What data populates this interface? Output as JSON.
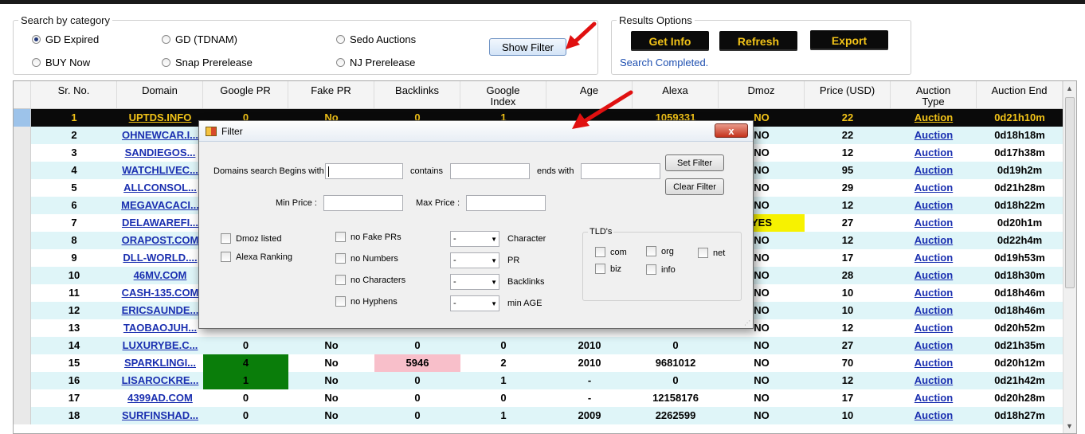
{
  "search_category": {
    "legend": "Search by category",
    "options": [
      {
        "label": "GD Expired",
        "selected": true
      },
      {
        "label": "GD (TDNAM)",
        "selected": false
      },
      {
        "label": "Sedo Auctions",
        "selected": false
      },
      {
        "label": "BUY Now",
        "selected": false
      },
      {
        "label": "Snap Prerelease",
        "selected": false
      },
      {
        "label": "NJ Prerelease",
        "selected": false
      }
    ],
    "show_filter": "Show Filter"
  },
  "results_options": {
    "legend": "Results Options",
    "get_info": "Get Info",
    "refresh": "Refresh",
    "export": "Export",
    "status": "Search Completed."
  },
  "table": {
    "columns": [
      "Sr. No.",
      "Domain",
      "Google PR",
      "Fake PR",
      "Backlinks",
      "Google\nIndex",
      "Age",
      "Alexa",
      "Dmoz",
      "Price (USD)",
      "Auction\nType",
      "Auction End"
    ],
    "rows": [
      [
        "1",
        "UPTDS.INFO",
        "0",
        "No",
        "0",
        "1",
        "",
        "1059331",
        "NO",
        "22",
        "Auction",
        "0d21h10m"
      ],
      [
        "2",
        "OHNEWCAR.I...",
        "",
        "",
        "",
        "",
        "",
        "",
        "NO",
        "22",
        "Auction",
        "0d18h18m"
      ],
      [
        "3",
        "SANDIEGOS...",
        "",
        "",
        "",
        "",
        "",
        "",
        "NO",
        "12",
        "Auction",
        "0d17h38m"
      ],
      [
        "4",
        "WATCHLIVEC...",
        "",
        "",
        "",
        "",
        "",
        "",
        "NO",
        "95",
        "Auction",
        "0d19h2m"
      ],
      [
        "5",
        "ALLCONSOL...",
        "",
        "",
        "",
        "",
        "",
        "",
        "NO",
        "29",
        "Auction",
        "0d21h28m"
      ],
      [
        "6",
        "MEGAVACACI...",
        "",
        "",
        "",
        "",
        "",
        "",
        "NO",
        "12",
        "Auction",
        "0d18h22m"
      ],
      [
        "7",
        "DELAWAREFI...",
        "",
        "",
        "",
        "",
        "",
        "",
        "YES",
        "27",
        "Auction",
        "0d20h1m"
      ],
      [
        "8",
        "ORAPOST.COM",
        "",
        "",
        "",
        "",
        "",
        "",
        "NO",
        "12",
        "Auction",
        "0d22h4m"
      ],
      [
        "9",
        "DLL-WORLD....",
        "",
        "",
        "",
        "",
        "",
        "",
        "NO",
        "17",
        "Auction",
        "0d19h53m"
      ],
      [
        "10",
        "46MV.COM",
        "",
        "",
        "",
        "",
        "",
        "",
        "NO",
        "28",
        "Auction",
        "0d18h30m"
      ],
      [
        "11",
        "CASH-135.COM",
        "",
        "",
        "",
        "",
        "",
        "",
        "NO",
        "10",
        "Auction",
        "0d18h46m"
      ],
      [
        "12",
        "ERICSAUNDE...",
        "",
        "",
        "",
        "",
        "",
        "",
        "NO",
        "10",
        "Auction",
        "0d18h46m"
      ],
      [
        "13",
        "TAOBAOJUH...",
        "",
        "",
        "",
        "",
        "",
        "",
        "NO",
        "12",
        "Auction",
        "0d20h52m"
      ],
      [
        "14",
        "LUXURYBE.C...",
        "0",
        "No",
        "0",
        "0",
        "2010",
        "0",
        "NO",
        "27",
        "Auction",
        "0d21h35m"
      ],
      [
        "15",
        "SPARKLINGI...",
        "4",
        "No",
        "5946",
        "2",
        "2010",
        "9681012",
        "NO",
        "70",
        "Auction",
        "0d20h12m"
      ],
      [
        "16",
        "LISAROCKRE...",
        "1",
        "No",
        "0",
        "1",
        "-",
        "0",
        "NO",
        "12",
        "Auction",
        "0d21h42m"
      ],
      [
        "17",
        "4399AD.COM",
        "0",
        "No",
        "0",
        "0",
        "-",
        "12158176",
        "NO",
        "17",
        "Auction",
        "0d20h28m"
      ],
      [
        "18",
        "SURFINSHAD...",
        "0",
        "No",
        "0",
        "1",
        "2009",
        "2262599",
        "NO",
        "10",
        "Auction",
        "0d18h27m"
      ]
    ]
  },
  "filter_dialog": {
    "title": "Filter",
    "close": "x",
    "begins_label": "Domains search Begins with",
    "contains_label": "contains",
    "ends_label": "ends with",
    "min_price_label": "Min Price :",
    "max_price_label": "Max Price :",
    "set_filter": "Set Filter",
    "clear_filter": "Clear Filter",
    "left_checks": [
      "Dmoz listed",
      "Alexa Ranking"
    ],
    "mid_checks": [
      "no Fake PRs",
      "no Numbers",
      "no Characters",
      "no Hyphens"
    ],
    "combo_value": "-",
    "combo_labels": [
      "Character",
      "PR",
      "Backlinks",
      "min AGE"
    ],
    "tld_legend": "TLD's",
    "tlds": [
      "com",
      "org",
      "net",
      "biz",
      "info"
    ]
  },
  "colors": {
    "accent_yellow": "#f2c318",
    "link_blue": "#1a2fb0",
    "highlight_green": "#0a7d0a",
    "highlight_pink": "#f8bfca",
    "highlight_yellow": "#f7f200"
  }
}
